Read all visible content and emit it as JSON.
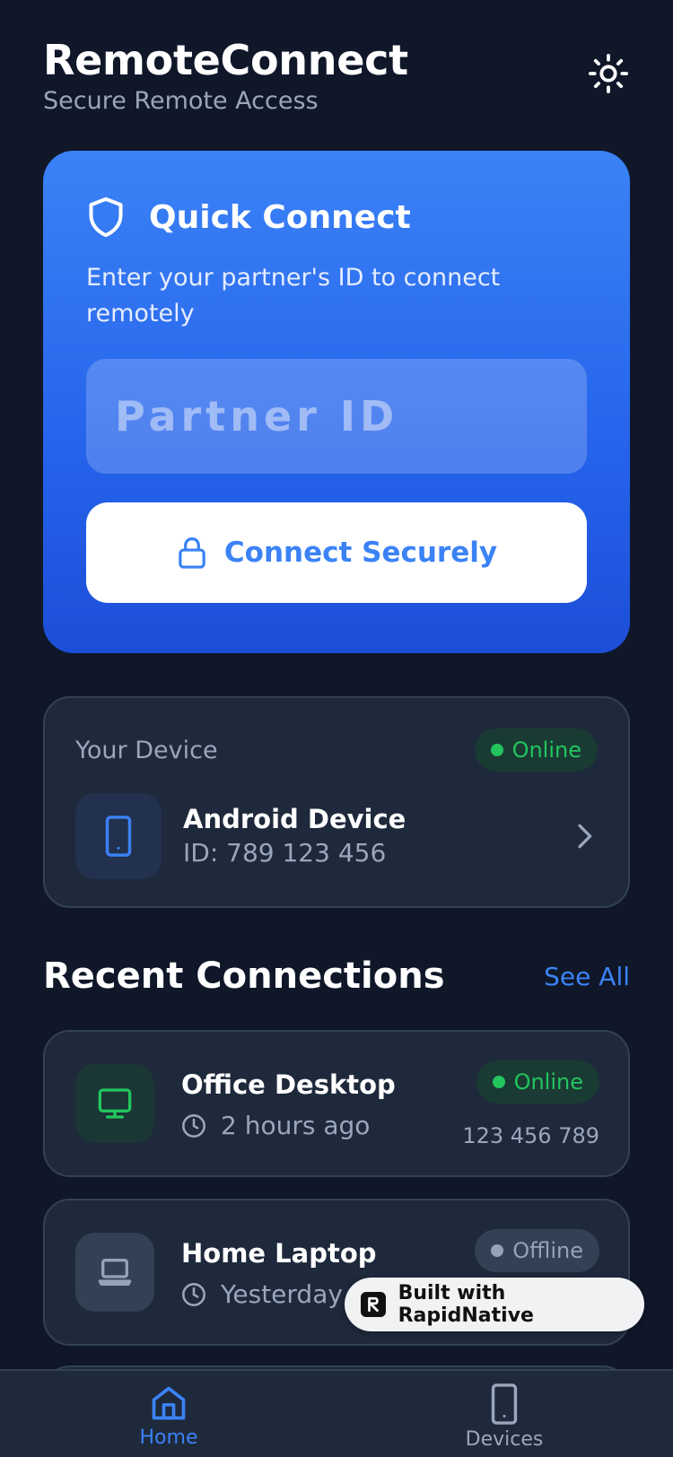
{
  "header": {
    "title": "RemoteConnect",
    "subtitle": "Secure Remote Access",
    "theme_icon": "sun-icon"
  },
  "quick_connect": {
    "title": "Quick Connect",
    "description": "Enter your partner's ID to connect remotely",
    "input_value": "",
    "input_placeholder": "Partner ID",
    "button_label": "Connect Securely"
  },
  "your_device": {
    "label": "Your Device",
    "status": "Online",
    "name": "Android Device",
    "id_text": "ID: 789 123 456"
  },
  "recent": {
    "title": "Recent Connections",
    "see_all": "See All",
    "items": [
      {
        "name": "Office Desktop",
        "time": "2 hours ago",
        "status": "Online",
        "id": "123 456 789",
        "icon": "monitor-icon"
      },
      {
        "name": "Home Laptop",
        "time": "Yesterday",
        "status": "Offline",
        "icon": "laptop-icon"
      }
    ]
  },
  "built_badge": {
    "text": "Built with RapidNative"
  },
  "nav": {
    "items": [
      {
        "label": "Home",
        "icon": "home-icon",
        "active": true
      },
      {
        "label": "Devices",
        "icon": "smartphone-icon",
        "active": false
      }
    ]
  },
  "colors": {
    "background": "#0f1729",
    "card": "#1e293b",
    "accent": "#3b82f6",
    "online": "#22c55e",
    "offline": "#94a3b8"
  }
}
